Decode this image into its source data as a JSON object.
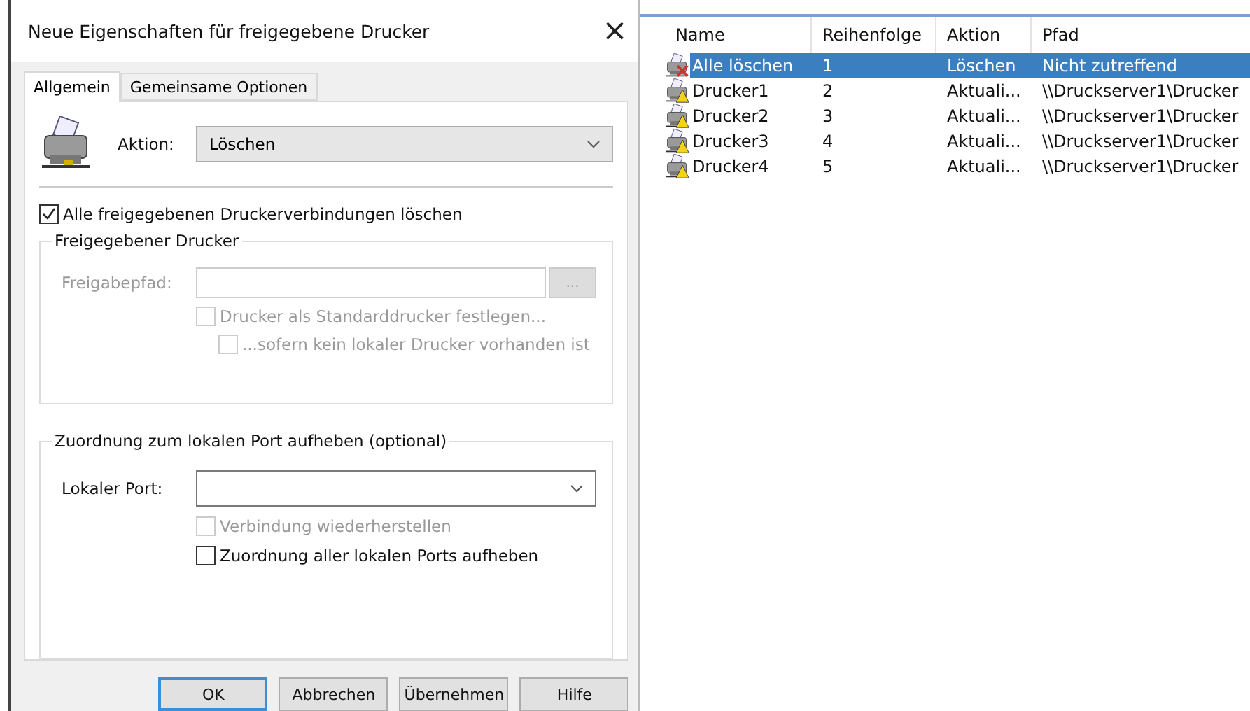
{
  "dialog": {
    "title": "Neue Eigenschaften für freigegebene Drucker",
    "close": "×",
    "tabs": [
      {
        "label": "Allgemein",
        "selected": true
      },
      {
        "label": "Gemeinsame Optionen",
        "selected": false
      }
    ],
    "action": {
      "label": "Aktion:",
      "value": "Löschen"
    },
    "delete_all": {
      "label": "Alle freigegebenen Druckerverbindungen löschen",
      "checked": true,
      "disabled": false
    },
    "shared_printer": {
      "title": "Freigegebener Drucker",
      "path_label": "Freigabepfad:",
      "browse": "...",
      "disabled": true,
      "options": [
        {
          "label": "Drucker als Standarddrucker festlegen...",
          "checked": false,
          "disabled": true,
          "indent": false
        },
        {
          "label": "...sofern kein lokaler Drucker vorhanden ist",
          "checked": false,
          "disabled": true,
          "indent": true
        }
      ]
    },
    "port": {
      "title": "Zuordnung zum lokalen Port aufheben (optional)",
      "port_label": "Lokaler Port:",
      "options": [
        {
          "label": "Verbindung wiederherstellen",
          "checked": false,
          "disabled": true
        },
        {
          "label": "Zuordnung aller lokalen Ports aufheben",
          "checked": false,
          "disabled": false
        }
      ]
    },
    "buttons": [
      {
        "label": "OK",
        "default": true
      },
      {
        "label": "Abbrechen",
        "default": false
      },
      {
        "label": "Übernehmen",
        "default": false
      },
      {
        "label": "Hilfe",
        "default": false
      }
    ]
  },
  "list": {
    "columns": [
      "Name",
      "Reihenfolge",
      "Aktion",
      "Pfad"
    ],
    "rows": [
      {
        "kind": "delete",
        "name": "Alle löschen",
        "order": "1",
        "action": "Löschen",
        "path": "Nicht zutreffend",
        "selected": true
      },
      {
        "kind": "update",
        "name": "Drucker1",
        "order": "2",
        "action": "Aktuali...",
        "path": "\\\\Druckserver1\\Drucker",
        "selected": false
      },
      {
        "kind": "update",
        "name": "Drucker2",
        "order": "3",
        "action": "Aktuali...",
        "path": "\\\\Druckserver1\\Drucker",
        "selected": false
      },
      {
        "kind": "update",
        "name": "Drucker3",
        "order": "4",
        "action": "Aktuali...",
        "path": "\\\\Druckserver1\\Drucker",
        "selected": false
      },
      {
        "kind": "update",
        "name": "Drucker4",
        "order": "5",
        "action": "Aktuali...",
        "path": "\\\\Druckserver1\\Drucker",
        "selected": false
      }
    ]
  }
}
